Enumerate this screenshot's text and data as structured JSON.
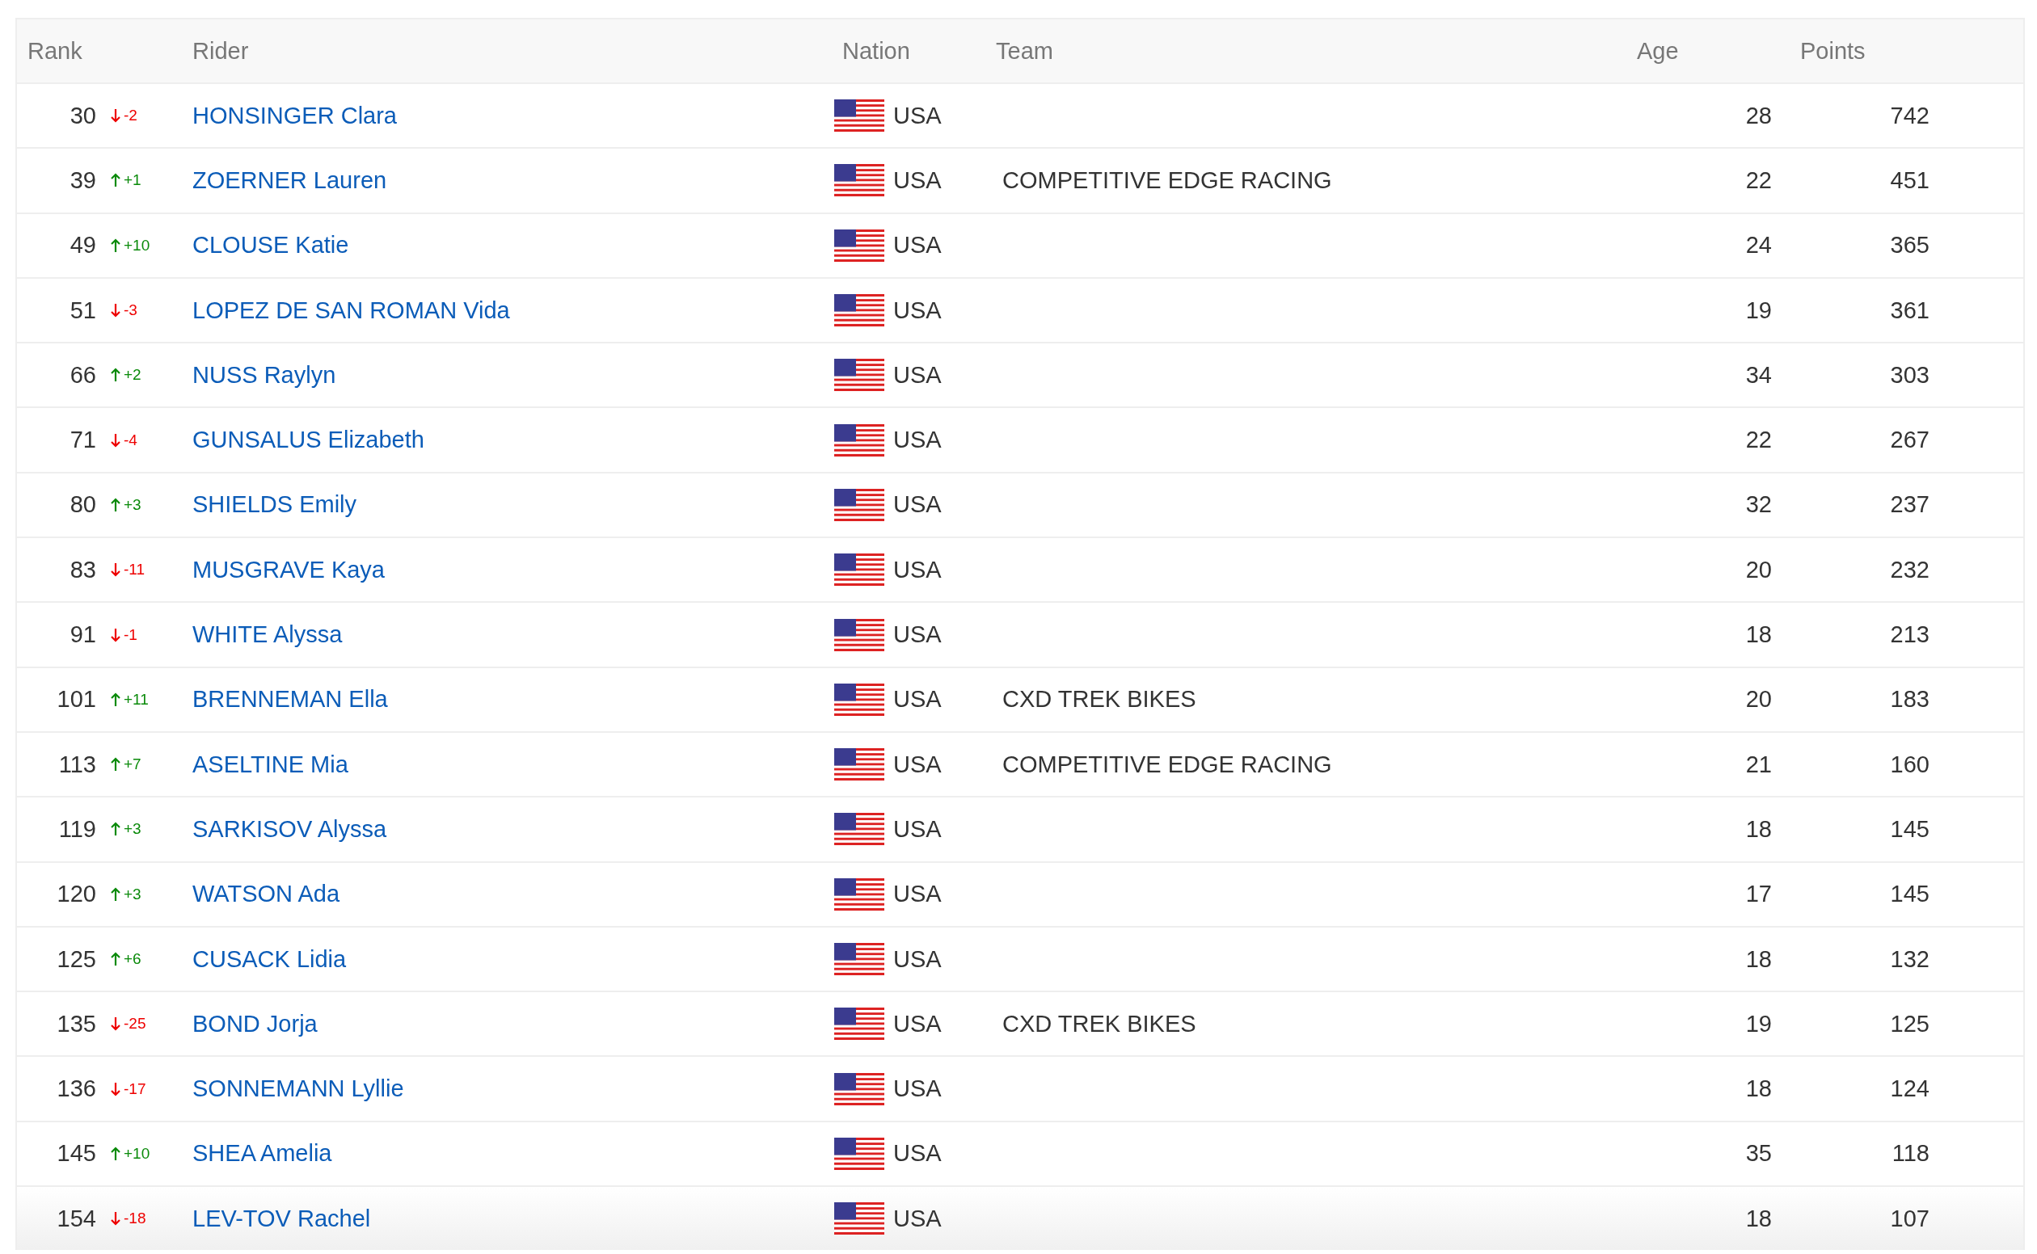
{
  "table": {
    "columns": [
      "Rank",
      "Rider",
      "Nation",
      "Team",
      "Age",
      "Points"
    ],
    "rows": [
      {
        "rank": "30",
        "change": {
          "kind": "down",
          "text": "-2"
        },
        "rider": "HONSINGER Clara",
        "nation": "USA",
        "team": "",
        "age": "28",
        "points": "742"
      },
      {
        "rank": "39",
        "change": {
          "kind": "up",
          "text": "+1"
        },
        "rider": "ZOERNER Lauren",
        "nation": "USA",
        "team": "COMPETITIVE EDGE RACING",
        "age": "22",
        "points": "451"
      },
      {
        "rank": "49",
        "change": {
          "kind": "up",
          "text": "+10"
        },
        "rider": "CLOUSE Katie",
        "nation": "USA",
        "team": "",
        "age": "24",
        "points": "365"
      },
      {
        "rank": "51",
        "change": {
          "kind": "down",
          "text": "-3"
        },
        "rider": "LOPEZ DE SAN ROMAN Vida",
        "nation": "USA",
        "team": "",
        "age": "19",
        "points": "361"
      },
      {
        "rank": "66",
        "change": {
          "kind": "up",
          "text": "+2"
        },
        "rider": "NUSS Raylyn",
        "nation": "USA",
        "team": "",
        "age": "34",
        "points": "303"
      },
      {
        "rank": "71",
        "change": {
          "kind": "down",
          "text": "-4"
        },
        "rider": "GUNSALUS Elizabeth",
        "nation": "USA",
        "team": "",
        "age": "22",
        "points": "267"
      },
      {
        "rank": "80",
        "change": {
          "kind": "up",
          "text": "+3"
        },
        "rider": "SHIELDS Emily",
        "nation": "USA",
        "team": "",
        "age": "32",
        "points": "237"
      },
      {
        "rank": "83",
        "change": {
          "kind": "down",
          "text": "-11"
        },
        "rider": "MUSGRAVE Kaya",
        "nation": "USA",
        "team": "",
        "age": "20",
        "points": "232"
      },
      {
        "rank": "91",
        "change": {
          "kind": "down",
          "text": "-1"
        },
        "rider": "WHITE Alyssa",
        "nation": "USA",
        "team": "",
        "age": "18",
        "points": "213"
      },
      {
        "rank": "101",
        "change": {
          "kind": "up",
          "text": "+11"
        },
        "rider": "BRENNEMAN Ella",
        "nation": "USA",
        "team": "CXD TREK BIKES",
        "age": "20",
        "points": "183"
      },
      {
        "rank": "113",
        "change": {
          "kind": "up",
          "text": "+7"
        },
        "rider": "ASELTINE Mia",
        "nation": "USA",
        "team": "COMPETITIVE EDGE RACING",
        "age": "21",
        "points": "160"
      },
      {
        "rank": "119",
        "change": {
          "kind": "up",
          "text": "+3"
        },
        "rider": "SARKISOV Alyssa",
        "nation": "USA",
        "team": "",
        "age": "18",
        "points": "145"
      },
      {
        "rank": "120",
        "change": {
          "kind": "up",
          "text": "+3"
        },
        "rider": "WATSON Ada",
        "nation": "USA",
        "team": "",
        "age": "17",
        "points": "145"
      },
      {
        "rank": "125",
        "change": {
          "kind": "up",
          "text": "+6"
        },
        "rider": "CUSACK Lidia",
        "nation": "USA",
        "team": "",
        "age": "18",
        "points": "132"
      },
      {
        "rank": "135",
        "change": {
          "kind": "down",
          "text": "-25"
        },
        "rider": "BOND Jorja",
        "nation": "USA",
        "team": "CXD TREK BIKES",
        "age": "19",
        "points": "125"
      },
      {
        "rank": "136",
        "change": {
          "kind": "down",
          "text": "-17"
        },
        "rider": "SONNEMANN Lyllie",
        "nation": "USA",
        "team": "",
        "age": "18",
        "points": "124"
      },
      {
        "rank": "145",
        "change": {
          "kind": "up",
          "text": "+10"
        },
        "rider": "SHEA Amelia",
        "nation": "USA",
        "team": "",
        "age": "35",
        "points": "118"
      },
      {
        "rank": "154",
        "change": {
          "kind": "down",
          "text": "-18"
        },
        "rider": "LEV-TOV Rachel",
        "nation": "USA",
        "team": "",
        "age": "18",
        "points": "107"
      }
    ]
  }
}
